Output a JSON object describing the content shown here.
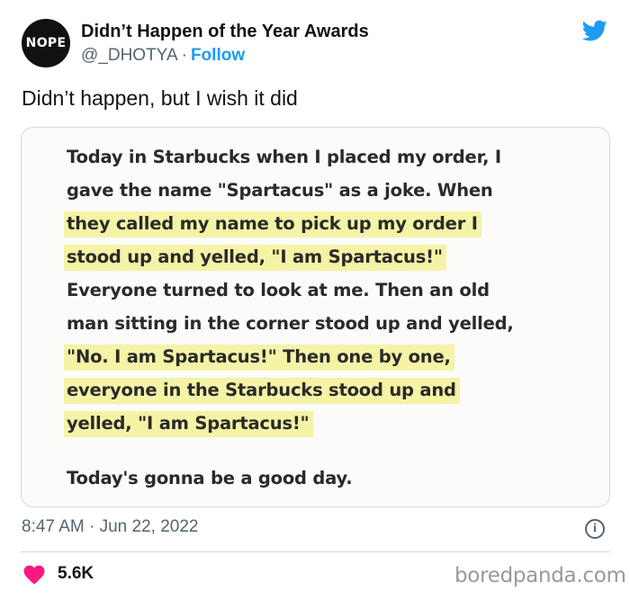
{
  "author": {
    "avatar_text": "NOPE",
    "display_name": "Didn’t Happen of the Year Awards",
    "handle": "@_DHOTYA",
    "separator": "·",
    "follow_label": "Follow"
  },
  "platform_icon": "twitter-bird-icon",
  "tweet": {
    "text": "Didn’t happen, but I wish it did"
  },
  "media": {
    "lines": [
      "Today in Starbucks when I placed my order, I",
      "gave the name \"Spartacus\" as a joke. When",
      "they called my name to pick up my order I",
      "stood up and yelled, \"I am Spartacus!\"",
      "Everyone turned to look at me. Then an old",
      "man sitting in the corner stood up and yelled,",
      "\"No. I am Spartacus!\" Then one by one,",
      "everyone in the Starbucks stood up and",
      "yelled, \"I am Spartacus!\""
    ],
    "closing": "Today's gonna be a good day."
  },
  "meta": {
    "timestamp": "8:47 AM · Jun 22, 2022",
    "info_icon": "info-icon",
    "info_glyph": "i"
  },
  "engagement": {
    "heart_icon": "heart-icon",
    "heart_color": "#f91880",
    "likes": "5.6K"
  },
  "watermark": "boredpanda.com",
  "colors": {
    "accent": "#1d9bf0",
    "muted": "#536471",
    "highlight": "#f4f3a6"
  }
}
